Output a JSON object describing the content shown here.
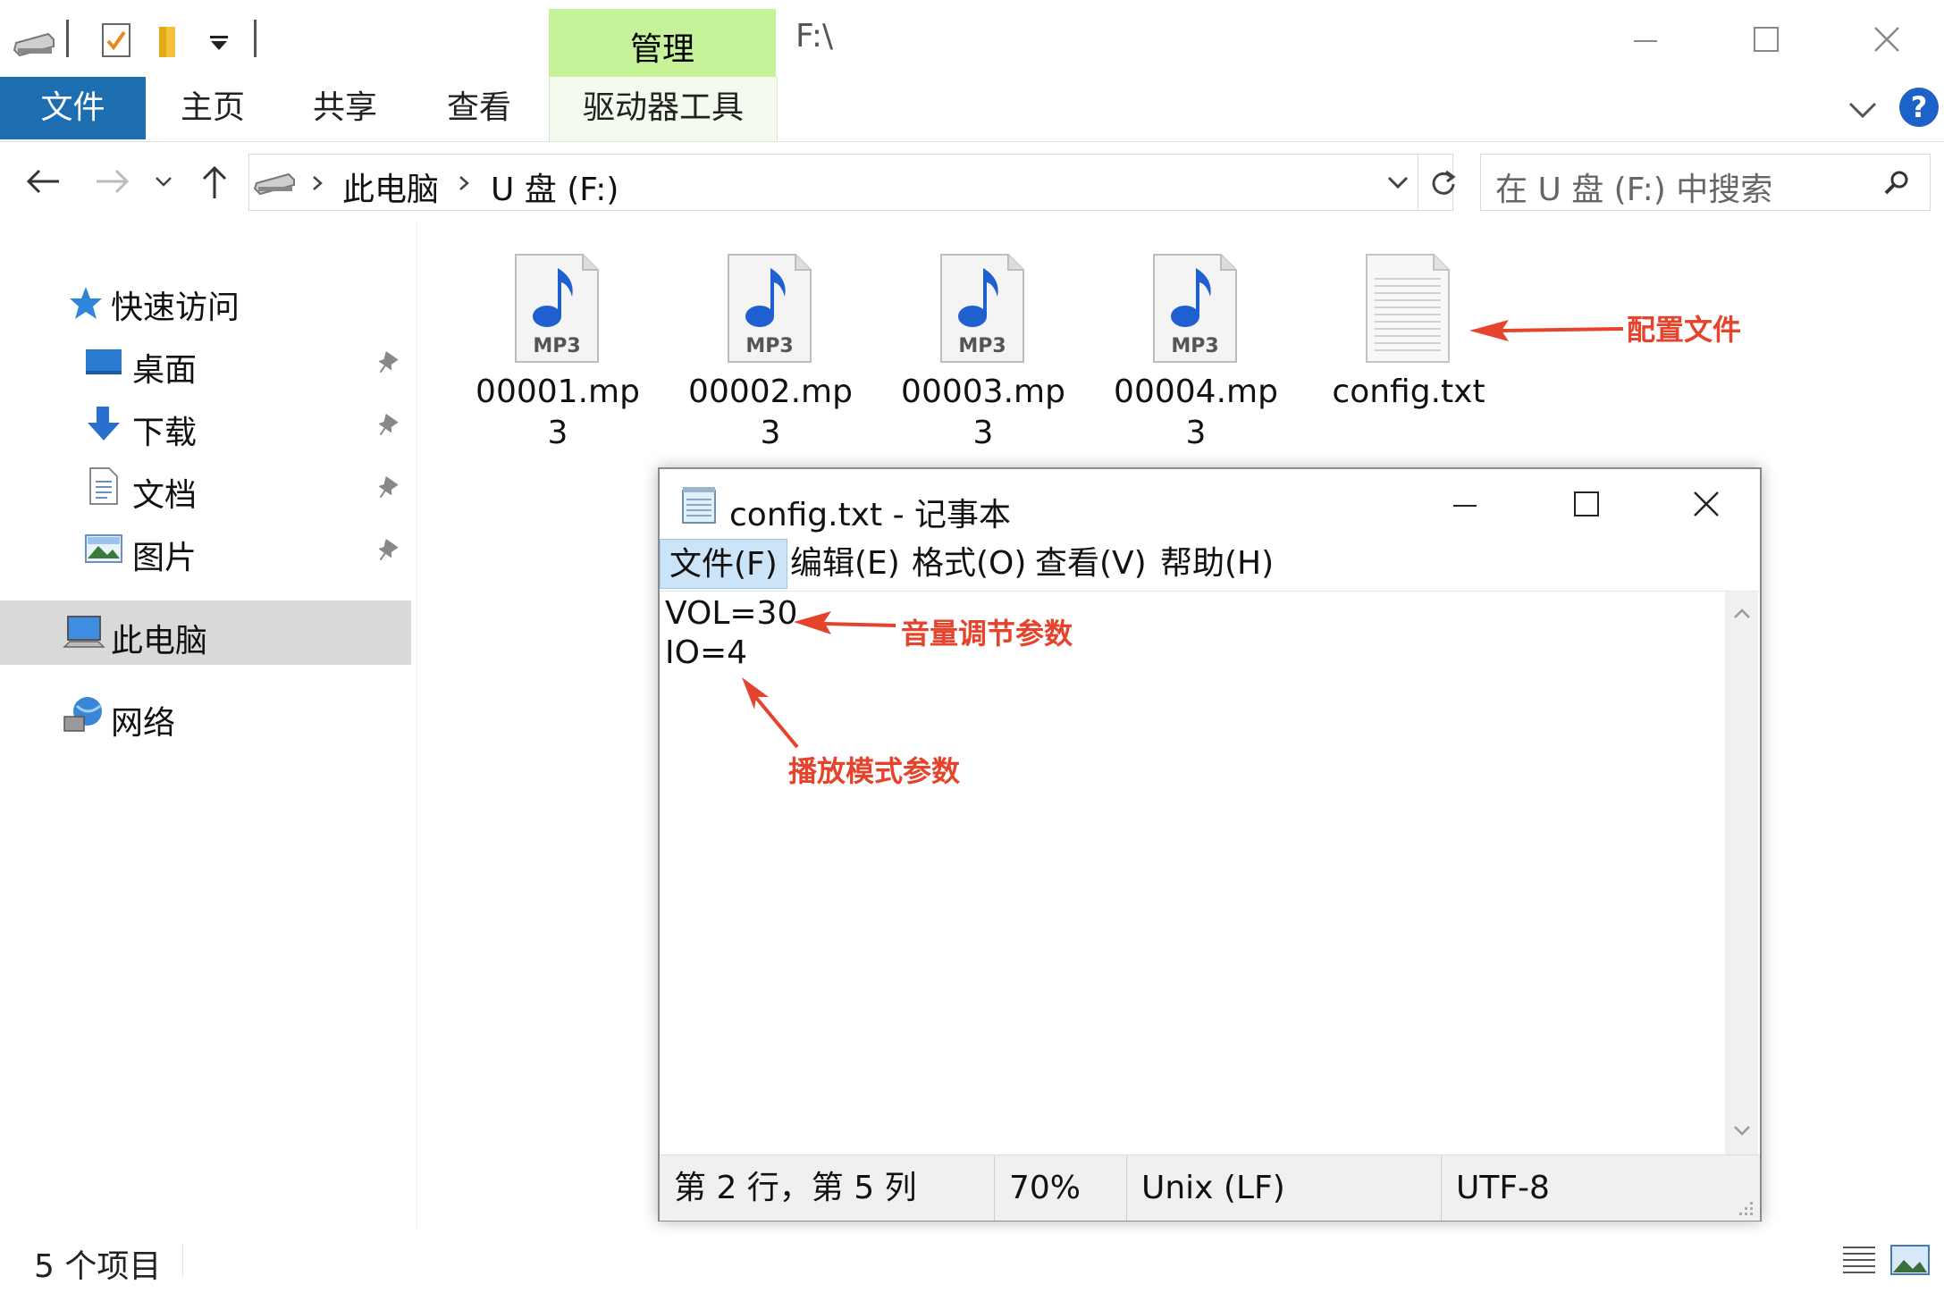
{
  "title_bar": {
    "manage_tab": "管理",
    "path": "F:\\",
    "minimize_icon": "minimize-icon",
    "maximize_icon": "maximize-icon",
    "close_icon": "close-icon"
  },
  "ribbon": {
    "tabs": [
      "文件",
      "主页",
      "共享",
      "查看"
    ],
    "drive_tools": "驱动器工具",
    "help": "?"
  },
  "nav": {
    "breadcrumb": [
      "此电脑",
      "U 盘 (F:)"
    ],
    "search_placeholder": "在 U 盘 (F:) 中搜索"
  },
  "sidebar": {
    "quick_access": "快速访问",
    "items": [
      "桌面",
      "下载",
      "文档",
      "图片"
    ],
    "this_pc": "此电脑",
    "network": "网络"
  },
  "files": [
    {
      "name_line1": "00001.mp",
      "name_line2": "3",
      "icon_label": "MP3"
    },
    {
      "name_line1": "00002.mp",
      "name_line2": "3",
      "icon_label": "MP3"
    },
    {
      "name_line1": "00003.mp",
      "name_line2": "3",
      "icon_label": "MP3"
    },
    {
      "name_line1": "00004.mp",
      "name_line2": "3",
      "icon_label": "MP3"
    },
    {
      "name_line1": "config.txt",
      "name_line2": "",
      "icon_label": ""
    }
  ],
  "status_bar": {
    "item_count": "5 个项目"
  },
  "notepad": {
    "title": "config.txt - 记事本",
    "menu": [
      "文件(F)",
      "编辑(E)",
      "格式(O)",
      "查看(V)",
      "帮助(H)"
    ],
    "lines": [
      "VOL=30",
      "IO=4"
    ],
    "status": {
      "position": "第 2 行，第 5 列",
      "zoom": "70%",
      "line_ending": "Unix (LF)",
      "encoding": "UTF-8"
    }
  },
  "annotations": {
    "config_file": "配置文件",
    "volume_param": "音量调节参数",
    "play_mode_param": "播放模式参数",
    "color": "#e5432b"
  }
}
